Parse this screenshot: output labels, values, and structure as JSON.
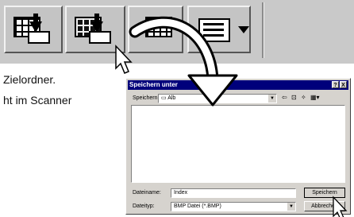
{
  "instruction_lines": [
    "Zielordner.",
    "ht im Scanner"
  ],
  "dialog": {
    "title": "Speichern unter",
    "title_buttons": [
      "?",
      "X"
    ],
    "save_in_label": "Speichern",
    "save_in_value": "Alb",
    "nav_icons": [
      "back-arrow-icon",
      "up-folder-icon",
      "new-folder-icon",
      "view-menu-icon"
    ],
    "filename_label": "Dateiname:",
    "filename_value": "Index",
    "filetype_label": "Dateityp:",
    "filetype_value": "BMP Datei (*.BMP)",
    "save_button": "Speichern",
    "cancel_button": "Abbrechen"
  },
  "colors": {
    "toolbar": "#c9c9c9",
    "titlebar": "#00007b",
    "dialog": "#d6d3ce"
  }
}
